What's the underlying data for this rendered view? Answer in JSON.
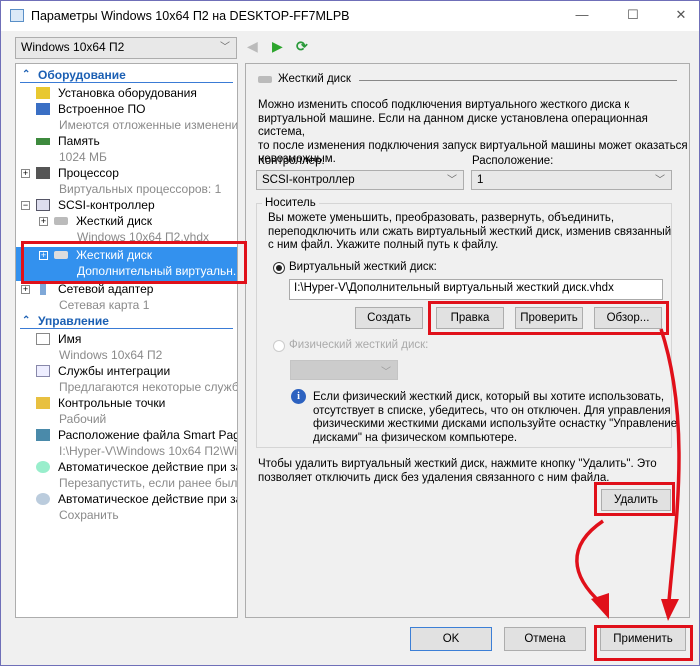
{
  "window": {
    "title": "Параметры Windows 10x64 П2 на DESKTOP-FF7MLPB",
    "minimize": "—",
    "maximize": "☐",
    "close": "✕"
  },
  "vm_selector": {
    "value": "Windows 10x64 П2"
  },
  "tree": {
    "hardware_section": "Оборудование",
    "items": [
      {
        "label": "Установка оборудования"
      },
      {
        "label": "Встроенное ПО",
        "sub": "Имеются отложенные изменени..."
      },
      {
        "label": "Память",
        "sub": "1024 МБ"
      },
      {
        "label": "Процессор",
        "sub": "Виртуальных процессоров: 1"
      },
      {
        "label": "SCSI-контроллер"
      },
      {
        "label": "Жесткий диск",
        "sub": "Windows 10x64 П2.vhdx"
      },
      {
        "label": "Жесткий диск",
        "sub": "Дополнительный виртуальн..."
      },
      {
        "label": "Сетевой адаптер",
        "sub": "Сетевая карта 1"
      }
    ],
    "management_section": "Управление",
    "mgmt": [
      {
        "label": "Имя",
        "sub": "Windows 10x64 П2"
      },
      {
        "label": "Службы интеграции",
        "sub": "Предлагаются некоторые службы"
      },
      {
        "label": "Контрольные точки",
        "sub": "Рабочий"
      },
      {
        "label": "Расположение файла Smart Paging",
        "sub": "I:\\Hyper-V\\Windows 10x64 П2\\Wi..."
      },
      {
        "label": "Автоматическое действие при за...",
        "sub": "Перезапустить, если ранее был ..."
      },
      {
        "label": "Автоматическое действие при за...",
        "sub": "Сохранить"
      }
    ]
  },
  "panel": {
    "header": "Жесткий диск",
    "intro": [
      "Можно изменить способ подключения виртуального жесткого диска к",
      "виртуальной машине. Если на данном диске установлена операционная система,",
      "то после изменения подключения запуск виртуальной машины может оказаться",
      "невозможным."
    ],
    "controller_label": "Контроллер:",
    "controller_value": "SCSI-контроллер",
    "location_label": "Расположение:",
    "location_value": "1",
    "media_label": "Носитель",
    "media_text": [
      "Вы можете уменьшить, преобразовать, развернуть, объединить,",
      "переподключить или сжать виртуальный жесткий диск, изменив связанный",
      "с ним файл. Укажите полный путь к файлу."
    ],
    "vhd_radio": "Виртуальный жесткий диск:",
    "vhd_path": "I:\\Hyper-V\\Дополнительный виртуальный жесткий диск.vhdx",
    "buttons": {
      "create": "Создать",
      "edit": "Правка",
      "inspect": "Проверить",
      "browse": "Обзор..."
    },
    "physical_radio": "Физический жесткий диск:",
    "info": [
      "Если физический жесткий диск, который вы хотите использовать,",
      "отсутствует в списке, убедитесь, что он отключен. Для управления",
      "физическими жесткими дисками используйте оснастку \"Управление",
      "дисками\" на физическом компьютере."
    ],
    "remove_text": [
      "Чтобы удалить виртуальный жесткий диск, нажмите кнопку \"Удалить\". Это",
      "позволяет отключить диск без удаления связанного с ним файла."
    ],
    "remove_button": "Удалить"
  },
  "footer": {
    "ok": "OK",
    "cancel": "Отмена",
    "apply": "Применить"
  },
  "colors": {
    "annotation": "#e0101a",
    "selection": "#3391ee",
    "section": "#1b5fb3"
  }
}
